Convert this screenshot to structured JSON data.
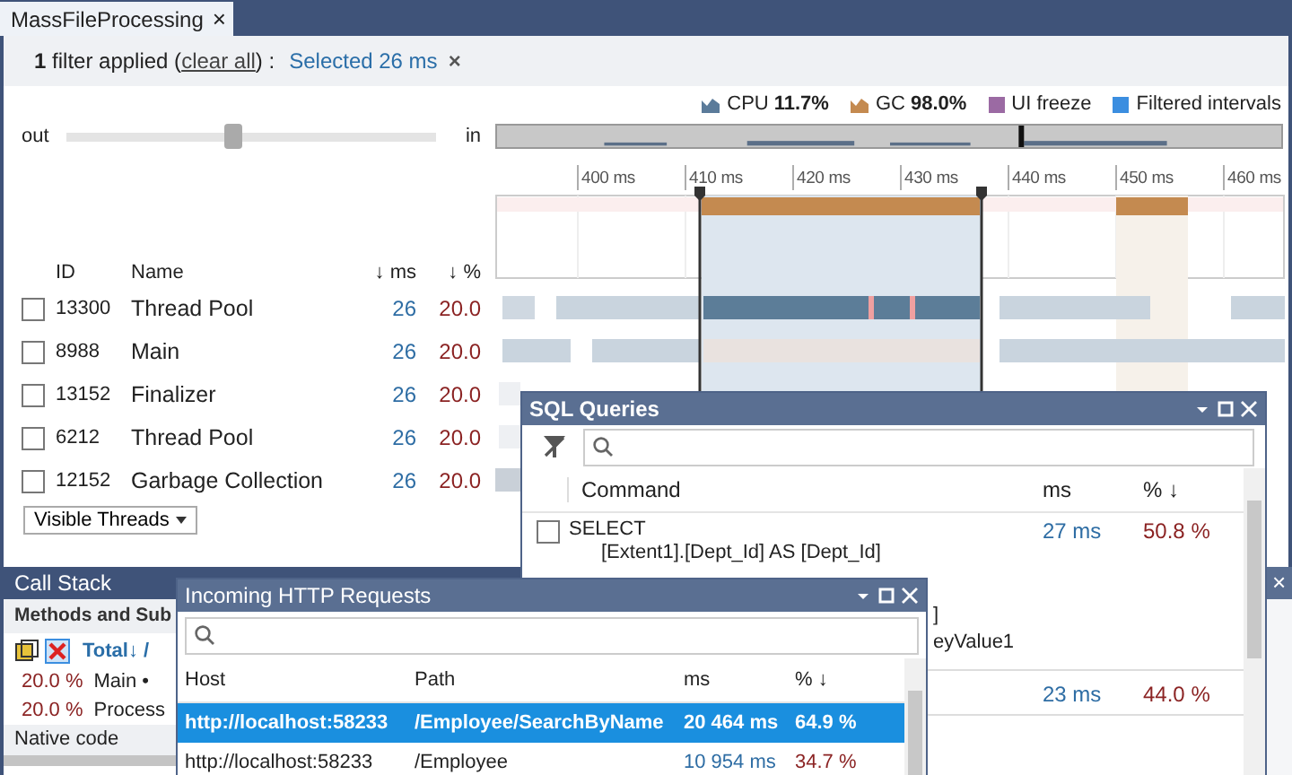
{
  "tab": {
    "title": "MassFileProcessing",
    "close": "×"
  },
  "filter_bar": {
    "summary_prefix": "**1** filter applied (",
    "clear_link": "clear all",
    "summary_suffix": ") :",
    "chip": "Selected 26 ms",
    "chip_close": "×"
  },
  "legend": [
    {
      "kind": "area",
      "label": "CPU",
      "value": "11.7%",
      "color": "#5b7b9a"
    },
    {
      "kind": "area",
      "label": "GC",
      "value": "98.0%",
      "color": "#c48a50"
    },
    {
      "kind": "square",
      "label": "UI freeze",
      "color": "#9b6aa3"
    },
    {
      "kind": "square",
      "label": "Filtered intervals",
      "color": "#3b8ee0"
    }
  ],
  "zoom": {
    "out_label": "out",
    "in_label": "in",
    "level": 0.45
  },
  "timeline": {
    "ticks": [
      "400 ms",
      "410 ms",
      "420 ms",
      "430 ms",
      "440 ms",
      "450 ms",
      "460 ms"
    ]
  },
  "threads": {
    "columns": [
      "ID",
      "Name",
      "↓ ms",
      "↓ %"
    ],
    "rows": [
      {
        "checked": false,
        "id": "13300",
        "name": "Thread Pool",
        "ms": "26",
        "pct": "20.0"
      },
      {
        "checked": false,
        "id": "8988",
        "name": "Main",
        "ms": "26",
        "pct": "20.0"
      },
      {
        "checked": false,
        "id": "13152",
        "name": "Finalizer",
        "ms": "26",
        "pct": "20.0"
      },
      {
        "checked": false,
        "id": "6212",
        "name": "Thread Pool",
        "ms": "26",
        "pct": "20.0"
      },
      {
        "checked": false,
        "id": "12152",
        "name": "Garbage Collection",
        "ms": "26",
        "pct": "20.0"
      }
    ],
    "dropdown": "Visible Threads"
  },
  "call_stack": {
    "title": "Call Stack",
    "header": "Methods and Sub",
    "toolbar_text": "Total↓ /",
    "rows": [
      {
        "percent": "20.0 %",
        "name": "Main •"
      },
      {
        "percent": "20.0 %",
        "name": "Process"
      }
    ],
    "footer": "Native code"
  },
  "sql_window": {
    "title": "SQL Queries",
    "columns": [
      "Command",
      "ms",
      "% ↓"
    ],
    "rows": [
      {
        "checked": false,
        "lines": [
          "SELECT",
          "[Extent1].[Dept_Id] AS [Dept_Id]"
        ],
        "fragments": [
          "]",
          "eyValue1"
        ],
        "ms": "27 ms",
        "pct": "50.8 %"
      },
      {
        "ms": "23 ms",
        "pct": "44.0 %"
      }
    ]
  },
  "http_window": {
    "title": "Incoming HTTP Requests",
    "columns": [
      "Host",
      "Path",
      "ms",
      "% ↓"
    ],
    "rows": [
      {
        "selected": true,
        "host": "http://localhost:58233",
        "path": "/Employee/SearchByName",
        "ms": "20 464 ms",
        "pct": "64.9 %"
      },
      {
        "selected": false,
        "host": "http://localhost:58233",
        "path": "/Employee",
        "ms": "10 954 ms",
        "pct": "34.7 %"
      }
    ]
  },
  "side_panel": {
    "close": "×"
  }
}
